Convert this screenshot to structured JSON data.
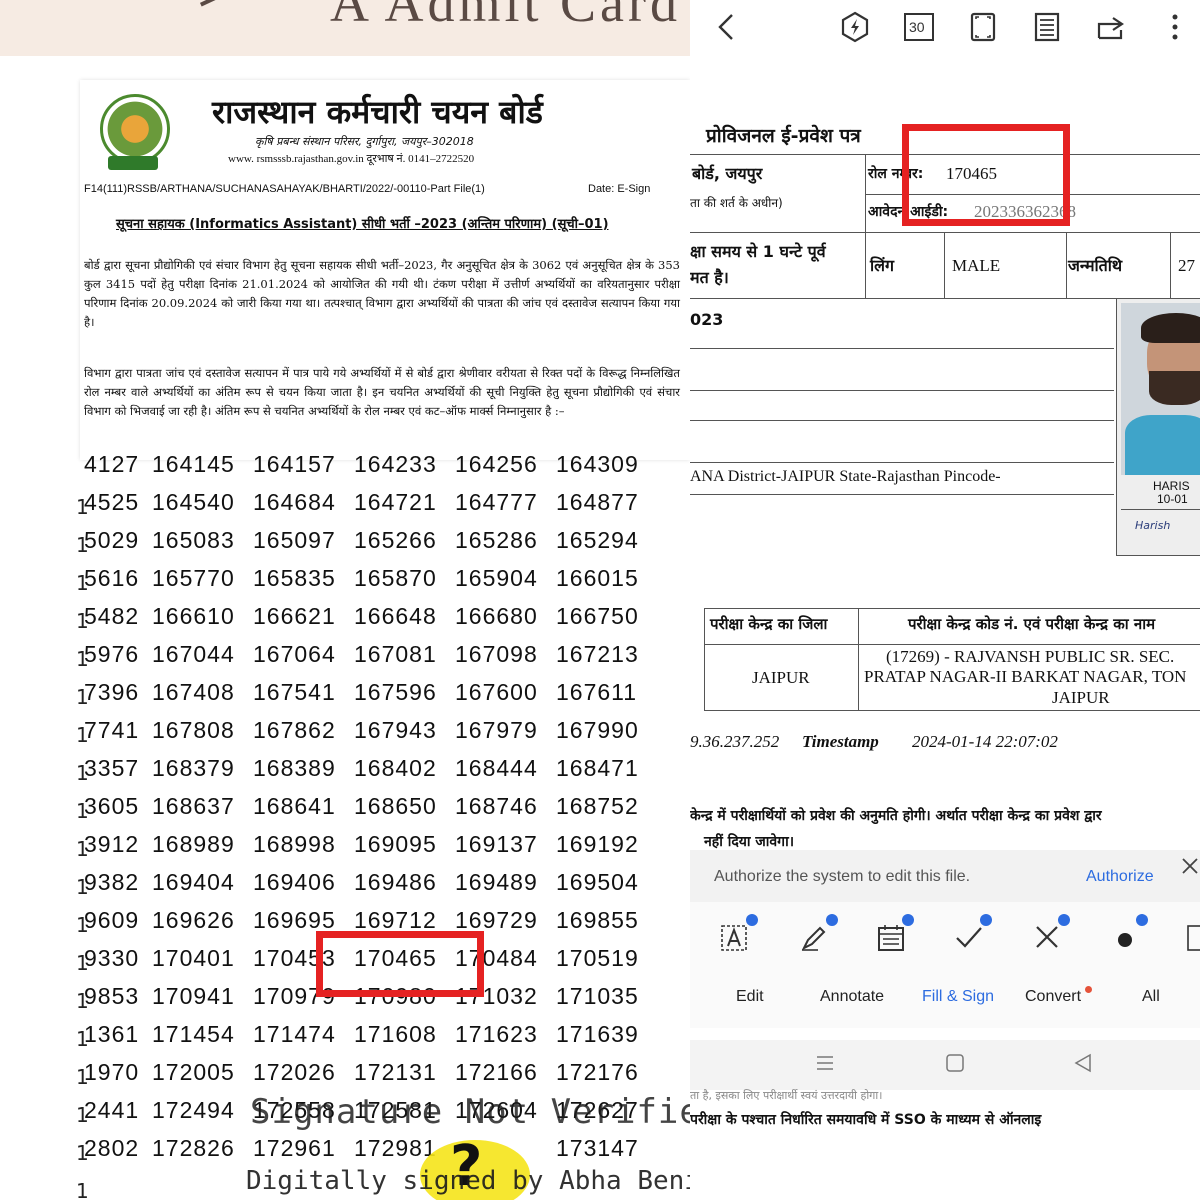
{
  "left": {
    "top_ghost_text": "A Admit Card",
    "board_title": "राजस्थान कर्मचारी चयन बोर्ड",
    "board_subtitle": "कृषि प्रबन्ध संस्थान परिसर, दुर्गापुरा, जयपुर–302018",
    "board_web": "www. rsmsssb.rajasthan.gov.in दूरभाष नं. 0141–2722520",
    "ref_no": "F14(111)RSSB/ARTHANA/SUCHANASAHAYAK/BHARTI/2022/-00110-Part File(1)",
    "ref_date": "Date: E-Sign",
    "heading": "सूचना सहायक (Informatics Assistant) सीधी भर्ती –2023 (अन्तिम परिणाम) (सूची–01)",
    "para1": "बोर्ड द्वारा सूचना प्रौद्योगिकी एवं संचार विभाग हेतु सूचना सहायक सीधी भर्ती–2023, गैर अनुसूचित क्षेत्र के 3062 एवं अनुसूचित क्षेत्र के 353 कुल 3415 पदों हेतु परीक्षा दिनांक 21.01.2024 को आयोजित की गयी थी। टंकण परीक्षा में उत्तीर्ण अभ्यर्थियों का वरियतानुसार परीक्षा परिणाम दिनांक 20.09.2024 को जारी किया गया था। तत्पश्चात् विभाग द्वारा अभ्यर्थियों की पात्रता की जांच एवं दस्तावेज सत्यापन किया गया है।",
    "para2": "विभाग द्वारा पात्रता जांच एवं दस्तावेज सत्यापन में पात्र पाये गये अभ्यर्थियों में से बोर्ड द्वारा श्रेणीवार वरीयता से रिक्त पदों के विरूद्ध निम्नलिखित रोल नम्बर वाले अभ्यर्थियों का अंतिम रूप से चयन किया जाता है। इन चयनित अभ्यर्थियों की सूची नियुक्ति हेतु सूचना प्रौद्योगिकी एवं संचार विभाग को भिजवाई जा रही है। अंतिम रूप से चयनित अभ्यर्थियों के रोल नम्बर एवं कट–ऑफ मार्क्स निम्नानुसार है :–",
    "rows": [
      {
        "lead": "",
        "partial": "4127",
        "nums": [
          "164145",
          "164157",
          "164233",
          "164256",
          "164309"
        ]
      },
      {
        "lead": "1",
        "partial": "4525",
        "nums": [
          "164540",
          "164684",
          "164721",
          "164777",
          "164877"
        ]
      },
      {
        "lead": "1",
        "partial": "5029",
        "nums": [
          "165083",
          "165097",
          "165266",
          "165286",
          "165294"
        ]
      },
      {
        "lead": "1",
        "partial": "5616",
        "nums": [
          "165770",
          "165835",
          "165870",
          "165904",
          "166015"
        ]
      },
      {
        "lead": "1",
        "partial": "5482",
        "nums": [
          "166610",
          "166621",
          "166648",
          "166680",
          "166750"
        ]
      },
      {
        "lead": "1",
        "partial": "5976",
        "nums": [
          "167044",
          "167064",
          "167081",
          "167098",
          "167213"
        ]
      },
      {
        "lead": "1",
        "partial": "7396",
        "nums": [
          "167408",
          "167541",
          "167596",
          "167600",
          "167611"
        ]
      },
      {
        "lead": "1",
        "partial": "7741",
        "nums": [
          "167808",
          "167862",
          "167943",
          "167979",
          "167990"
        ]
      },
      {
        "lead": "1",
        "partial": "3357",
        "nums": [
          "168379",
          "168389",
          "168402",
          "168444",
          "168471"
        ]
      },
      {
        "lead": "1",
        "partial": "3605",
        "nums": [
          "168637",
          "168641",
          "168650",
          "168746",
          "168752"
        ]
      },
      {
        "lead": "1",
        "partial": "3912",
        "nums": [
          "168989",
          "168998",
          "169095",
          "169137",
          "169192"
        ]
      },
      {
        "lead": "1",
        "partial": "9382",
        "nums": [
          "169404",
          "169406",
          "169486",
          "169489",
          "169504"
        ]
      },
      {
        "lead": "1",
        "partial": "9609",
        "nums": [
          "169626",
          "169695",
          "169712",
          "169729",
          "169855"
        ]
      },
      {
        "lead": "1",
        "partial": "9330",
        "nums": [
          "170401",
          "170453",
          "170465",
          "170484",
          "170519"
        ]
      },
      {
        "lead": "1",
        "partial": "9853",
        "nums": [
          "170941",
          "170979",
          "170980",
          "171032",
          "171035"
        ]
      },
      {
        "lead": "1",
        "partial": "1361",
        "nums": [
          "171454",
          "171474",
          "171608",
          "171623",
          "171639"
        ]
      },
      {
        "lead": "1",
        "partial": "1970",
        "nums": [
          "172005",
          "172026",
          "172131",
          "172166",
          "172176"
        ]
      },
      {
        "lead": "1",
        "partial": "2441",
        "nums": [
          "172494",
          "172558",
          "172581",
          "172604",
          "172627"
        ]
      },
      {
        "lead": "1",
        "partial": "2802",
        "nums": [
          "172826",
          "172961",
          "172981",
          "",
          "173147"
        ]
      },
      {
        "lead": "1",
        "partial": "",
        "nums": [
          "",
          "",
          "",
          "",
          ""
        ]
      }
    ],
    "watermark_line1": "Signature Not Verified",
    "watermark_line2": "Digitally signed by Abha Beniwal"
  },
  "right": {
    "doc_title": "प्रोविजनल ई-प्रवेश पत्र",
    "board_cell": "बोर्ड, जयपुर",
    "condition_cell": "ता की शर्त के अधीन)",
    "roll_label": "रोल नम्बर:",
    "roll_value": "170465",
    "app_label": "आवेदन आईडी:",
    "app_value": "202336362368",
    "time_note_1": "क्षा समय से 1 घन्टे पूर्व",
    "time_note_2": "मत है।",
    "gender_label": "लिंग",
    "gender_value": "MALE",
    "dob_label": "जन्मतिथि",
    "dob_value": "27",
    "year_text": "023",
    "address": "ANA District-JAIPUR State-Rajasthan Pincode-",
    "photo_name": "HARIS",
    "photo_date": "10-01",
    "photo_sign": "Harish",
    "centre_district_header": "परीक्षा केन्द्र का जिला",
    "centre_code_header": "परीक्षा केन्द्र कोड नं. एवं परीक्षा केन्द्र का नाम",
    "centre_district": "JAIPUR",
    "centre_line1": "(17269) - RAJVANSH PUBLIC SR. SEC.",
    "centre_line2": "PRATAP NAGAR-II BARKAT NAGAR, TON",
    "centre_line3": "JAIPUR",
    "ip_text": "9.36.237.252",
    "timestamp_label": "Timestamp",
    "timestamp_value": "2024-01-14 22:07:02",
    "note1": "केन्द्र में परीक्षार्थियों को प्रवेश की अनुमति होगी। अर्थात परीक्षा केन्द्र का प्रवेश द्वार",
    "note2": "नहीं दिया जावेगा।",
    "auth_message": "Authorize the system to edit this file.",
    "auth_button": "Authorize",
    "tabs": [
      "Edit",
      "Annotate",
      "Fill & Sign",
      "Convert",
      "All"
    ],
    "lower_note1": "ता है, इसका लिए परीक्षार्थी स्वयं उत्तरदायी होगा।",
    "lower_note2": "परीक्षा के पश्चात निर्धारित समयावधि में SSO के माध्यम से ऑनलाइ",
    "toolbar_page": "30",
    "colors": {
      "highlight": "#e52222",
      "accent": "#2d6ce0",
      "active_tab": "#2d6ce0"
    }
  }
}
